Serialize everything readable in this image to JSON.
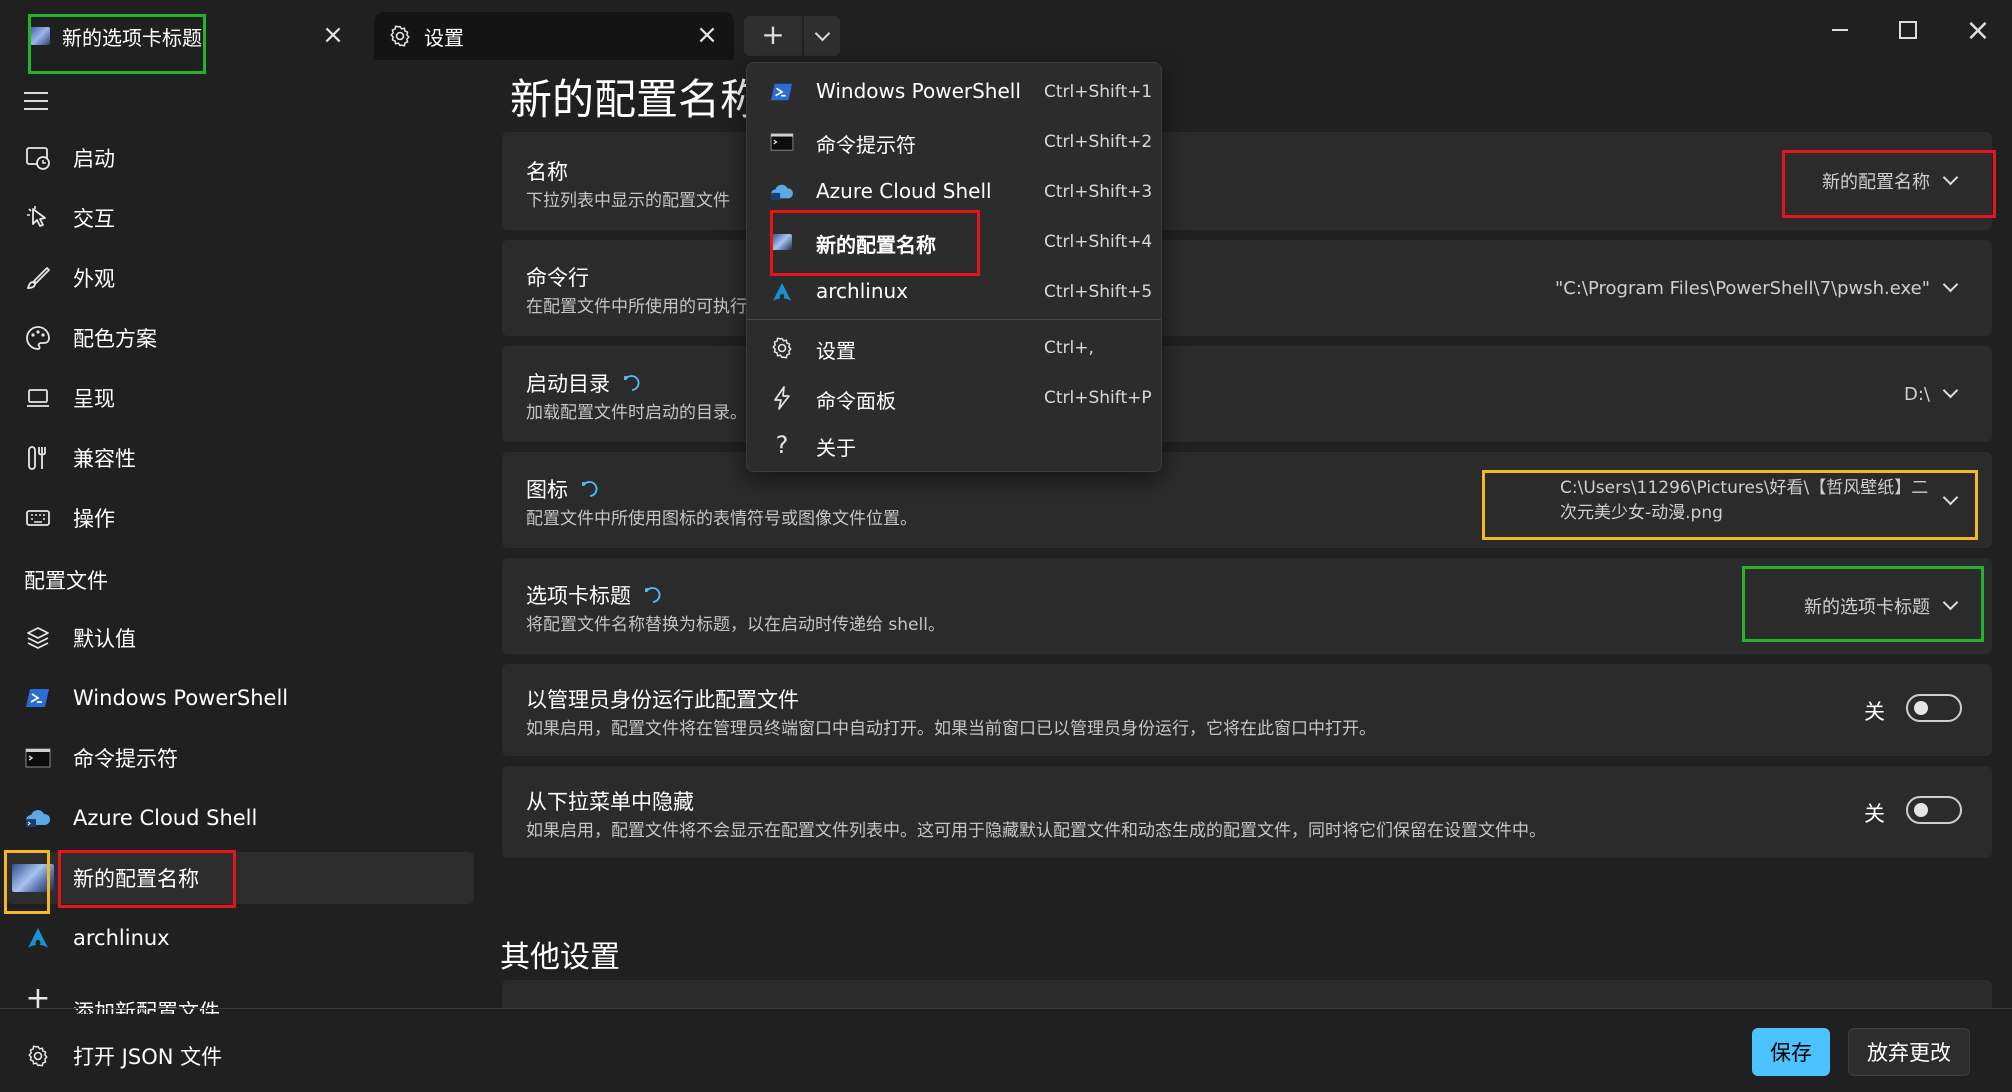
{
  "tabs": [
    {
      "title": "新的选项卡标题"
    },
    {
      "title": "设置"
    }
  ],
  "sidebar": {
    "items": [
      {
        "label": "启动"
      },
      {
        "label": "交互"
      },
      {
        "label": "外观"
      },
      {
        "label": "配色方案"
      },
      {
        "label": "呈现"
      },
      {
        "label": "兼容性"
      },
      {
        "label": "操作"
      }
    ],
    "profiles_header": "配置文件",
    "profiles": [
      {
        "label": "默认值"
      },
      {
        "label": "Windows PowerShell"
      },
      {
        "label": "命令提示符"
      },
      {
        "label": "Azure Cloud Shell"
      },
      {
        "label": "新的配置名称"
      },
      {
        "label": "archlinux"
      },
      {
        "label": "添加新配置文件"
      }
    ],
    "open_json": "打开 JSON 文件"
  },
  "main": {
    "page_title": "新的配置名称",
    "settings": [
      {
        "title": "名称",
        "desc": "下拉列表中显示的配置文件",
        "value": "新的配置名称"
      },
      {
        "title": "命令行",
        "desc": "在配置文件中所使用的可执行",
        "value": "\"C:\\Program Files\\PowerShell\\7\\pwsh.exe\""
      },
      {
        "title": "启动目录",
        "desc": "加载配置文件时启动的目录。",
        "value": "D:\\"
      },
      {
        "title": "图标",
        "desc": "配置文件中所使用图标的表情符号或图像文件位置。",
        "value_line1": "C:\\Users\\11296\\Pictures\\好看\\【哲风壁纸】二",
        "value_line2": "次元美少女-动漫.png"
      },
      {
        "title": "选项卡标题",
        "desc": "将配置文件名称替换为标题，以在启动时传递给 shell。",
        "value": "新的选项卡标题"
      },
      {
        "title": "以管理员身份运行此配置文件",
        "desc": "如果启用，配置文件将在管理员终端窗口中自动打开。如果当前窗口已以管理员身份运行，它将在此窗口中打开。",
        "toggle": "关"
      },
      {
        "title": "从下拉菜单中隐藏",
        "desc": "如果启用，配置文件将不会显示在配置文件列表中。这可用于隐藏默认配置文件和动态生成的配置文件，同时将它们保留在设置文件中。",
        "toggle": "关"
      }
    ],
    "section2_title": "其他设置",
    "save": "保存",
    "discard": "放弃更改"
  },
  "menu": {
    "items": [
      {
        "label": "Windows PowerShell",
        "shortcut": "Ctrl+Shift+1"
      },
      {
        "label": "命令提示符",
        "shortcut": "Ctrl+Shift+2"
      },
      {
        "label": "Azure Cloud Shell",
        "shortcut": "Ctrl+Shift+3"
      },
      {
        "label": "新的配置名称",
        "shortcut": "Ctrl+Shift+4"
      },
      {
        "label": "archlinux",
        "shortcut": "Ctrl+Shift+5"
      },
      {
        "label": "设置",
        "shortcut": "Ctrl+,"
      },
      {
        "label": "命令面板",
        "shortcut": "Ctrl+Shift+P"
      },
      {
        "label": "关于",
        "shortcut": ""
      }
    ]
  },
  "colors": {
    "accent": "#4cc2ff",
    "highlight_green": "#27b12c",
    "highlight_red": "#e5161b",
    "highlight_yellow": "#f2b826"
  }
}
